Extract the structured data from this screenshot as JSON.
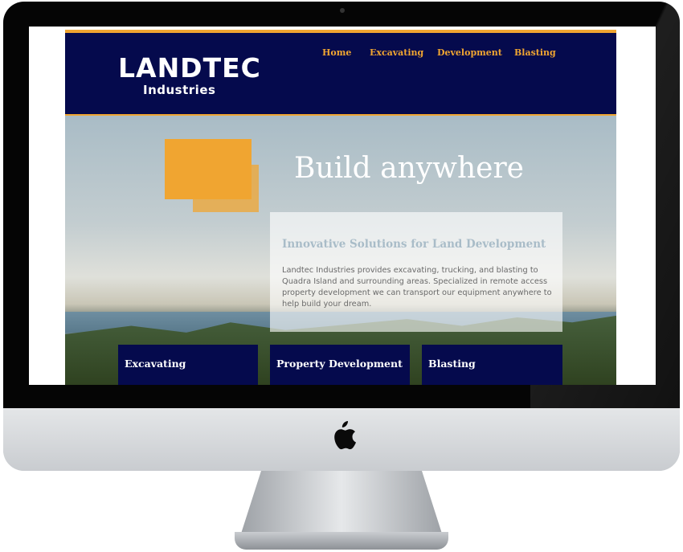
{
  "brand": {
    "name": "LANDTEC",
    "subname": "Industries"
  },
  "nav": {
    "items": [
      {
        "label": "Home"
      },
      {
        "label": "Excavating"
      },
      {
        "label": "Development"
      },
      {
        "label": "Blasting"
      }
    ]
  },
  "hero": {
    "title": "Build anywhere"
  },
  "info": {
    "title": "Innovative Solutions for Land Development",
    "text": "Landtec Industries provides excavating, trucking, and blasting to Quadra Island and surrounding areas. Specialized in remote access property development we can transport our equipment anywhere to help build your dream."
  },
  "tiles": [
    {
      "label": "Excavating"
    },
    {
      "label": "Property Development"
    },
    {
      "label": "Blasting"
    }
  ],
  "colors": {
    "navy": "#050a4d",
    "accent": "#f0a531"
  }
}
